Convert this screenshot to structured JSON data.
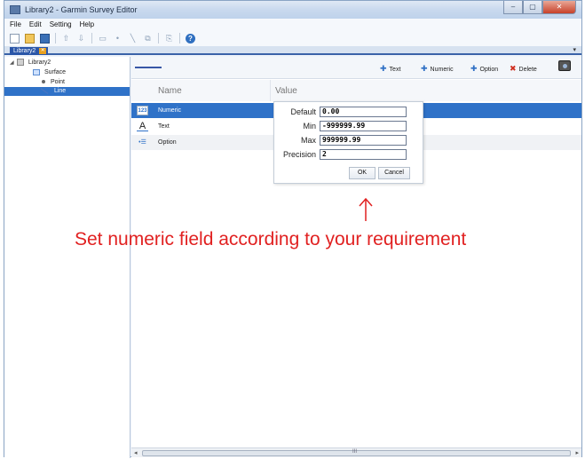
{
  "window": {
    "title": "Library2 - Garmin Survey Editor",
    "controls": {
      "minimize": "–",
      "maximize": "▢",
      "close": "✕"
    }
  },
  "menubar": {
    "items": [
      "File",
      "Edit",
      "Setting",
      "Help"
    ]
  },
  "toolbar": {
    "icons": [
      "new-icon",
      "open-icon",
      "save-icon",
      "move-up-icon",
      "move-down-icon",
      "add-surface-icon",
      "add-point-icon",
      "add-line-icon",
      "copy-icon",
      "paste-icon",
      "help-icon"
    ]
  },
  "tab": {
    "label": "Library2",
    "menu": "▾"
  },
  "tree": {
    "root": "Library2",
    "children": [
      "Surface",
      "Point",
      "Line"
    ],
    "selected": "Line"
  },
  "main_toolbar": {
    "buttons": {
      "text": "Text",
      "numeric": "Numeric",
      "option": "Option",
      "delete": "Delete"
    },
    "camera": "camera-icon"
  },
  "grid": {
    "headers": {
      "name": "Name",
      "value": "Value"
    },
    "rows": [
      {
        "name": "Numeric",
        "icon": "numeric-field-icon"
      },
      {
        "name": "Text",
        "icon": "text-field-icon"
      },
      {
        "name": "Option",
        "icon": "option-field-icon"
      }
    ]
  },
  "numeric_popup": {
    "default_label": "Default",
    "default_value": "0.00",
    "min_label": "Min",
    "min_value": "-999999.99",
    "max_label": "Max",
    "max_value": "999999.99",
    "precision_label": "Precision",
    "precision_value": "2",
    "ok_label": "OK",
    "cancel_label": "Cancel"
  },
  "scrollbar": {
    "left": "◂",
    "right": "▸",
    "grip": "III"
  },
  "annotation": {
    "text": "Set numeric field according to your requirement"
  },
  "colors": {
    "accent": "#2f72c8",
    "annotation": "#e12121",
    "titlebar": "#c9d9ee"
  }
}
